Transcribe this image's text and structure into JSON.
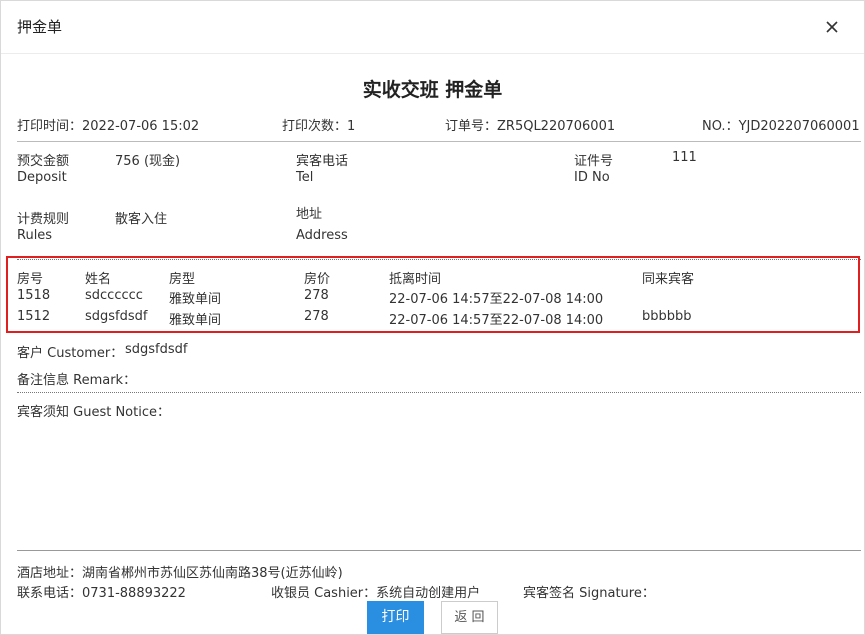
{
  "dialog": {
    "title": "押金单",
    "close_icon": "close-icon"
  },
  "doc_title": "实收交班 押金单",
  "meta": {
    "print_time": "打印时间：2022-07-06 15:02",
    "print_count": "打印次数：1",
    "order_no": "订单号：ZR5QL220706001",
    "no": "NO.：YJD202207060001"
  },
  "info": {
    "deposit_label": "预交金额",
    "deposit_label_en": "Deposit",
    "deposit_value": "756 (现金)",
    "tel_label": "宾客电话",
    "tel_label_en": "Tel",
    "id_label": "证件号",
    "id_label_en": "ID No",
    "id_value": "111",
    "rules_label": "计费规则",
    "rules_label_en": "Rules",
    "rules_value": "散客入住",
    "address_label": "地址",
    "address_label_en": "Address"
  },
  "table": {
    "headers": [
      "房号",
      "姓名",
      "房型",
      "房价",
      "抵离时间",
      "同来宾客"
    ],
    "rows": [
      [
        "1518",
        "sdcccccc",
        "雅致单间",
        "278",
        "22-07-06 14:57至22-07-08 14:00",
        ""
      ],
      [
        "1512",
        "sdgsfdsdf",
        "雅致单间",
        "278",
        "22-07-06 14:57至22-07-08 14:00",
        "bbbbbb"
      ]
    ]
  },
  "customer": {
    "label": "客户 Customer：",
    "value": "sdgsfdsdf"
  },
  "remark": {
    "label": "备注信息 Remark："
  },
  "notice": {
    "label": "宾客须知 Guest Notice："
  },
  "footer": {
    "hotel_address": "酒店地址：湖南省郴州市苏仙区苏仙南路38号(近苏仙岭)",
    "phone": "联系电话：0731-88893222",
    "cashier": "收银员 Cashier：系统自动创建用户",
    "signature": "宾客签名 Signature："
  },
  "buttons": {
    "print": "打印",
    "back": "返 回"
  },
  "colors": {
    "primary": "#2a8fe0",
    "highlight": "#e02020"
  }
}
